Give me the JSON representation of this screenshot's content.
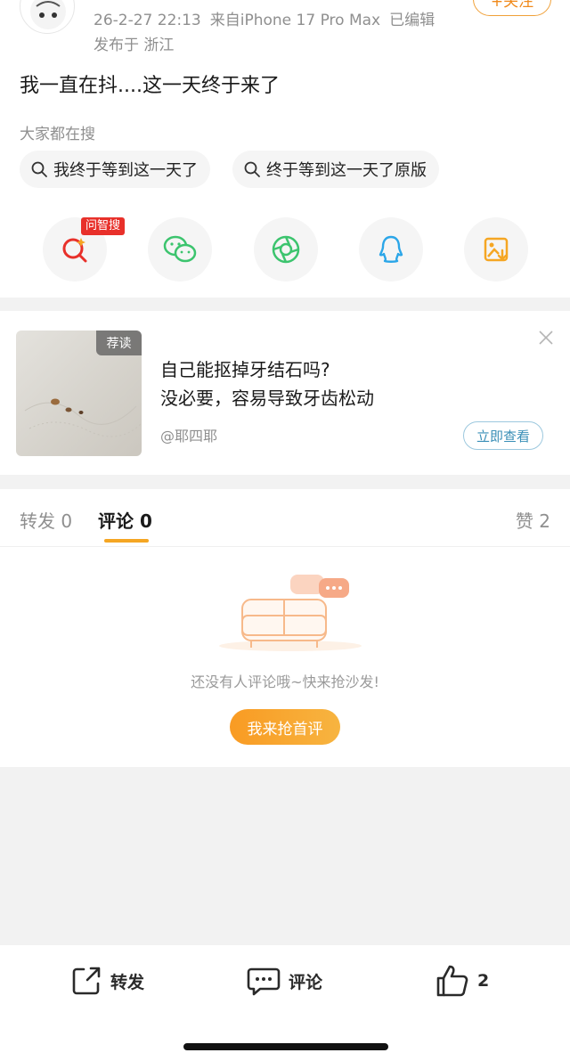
{
  "post": {
    "timestamp": "26-2-27 22:13",
    "source": "来自iPhone 17 Pro Max",
    "edited": "已编辑",
    "location": "发布于 浙江",
    "follow_label": "+关注",
    "text": "我一直在抖....这一天终于来了",
    "hot_search_label": "大家都在搜",
    "hot_searches": [
      {
        "label": "我终于等到这一天了"
      },
      {
        "label": "终于等到这一天了原版"
      }
    ],
    "share_tag": "问智搜",
    "share_icons": [
      "ai-search-icon",
      "wechat-icon",
      "moments-icon",
      "qq-icon",
      "save-image-icon"
    ]
  },
  "ad": {
    "badge": "荐读",
    "title_line1": "自己能抠掉牙结石吗?",
    "title_line2": "没必要，容易导致牙齿松动",
    "author": "@耶四耶",
    "cta": "立即查看"
  },
  "comments": {
    "tabs": [
      {
        "label": "转发",
        "count": "0"
      },
      {
        "label": "评论",
        "count": "0"
      },
      {
        "label": "赞",
        "count": "2"
      }
    ],
    "active_tab": "评论",
    "empty_text": "还没有人评论哦~快来抢沙发!",
    "first_comment_label": "我来抢首评"
  },
  "toolbar": {
    "repost_label": "转发",
    "comment_label": "评论",
    "like_count": "2"
  },
  "colors": {
    "accent_orange": "#f5a623",
    "tag_red": "#e8302a",
    "cta_blue": "#3a8fb7"
  }
}
